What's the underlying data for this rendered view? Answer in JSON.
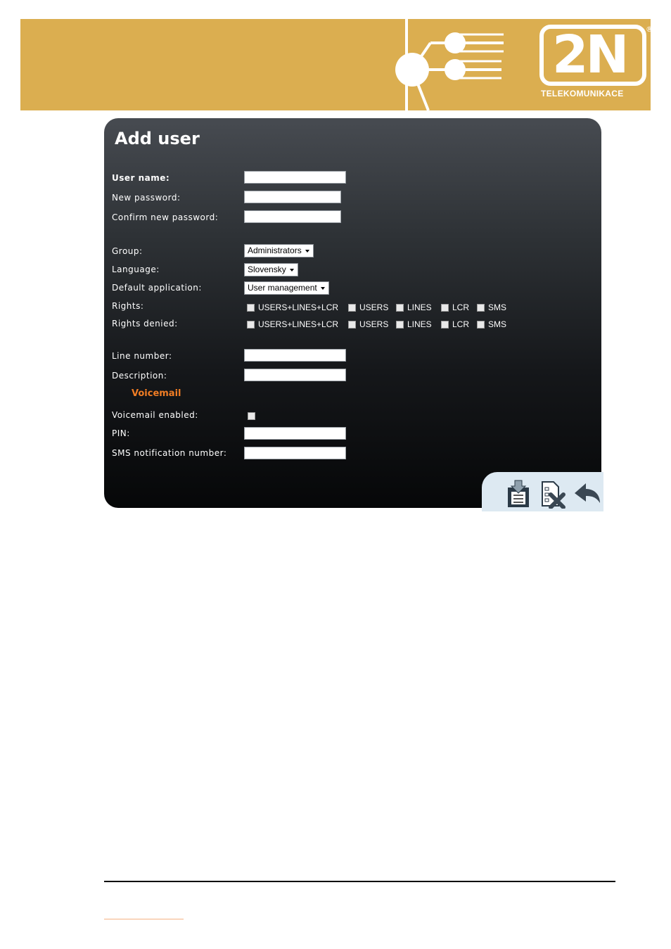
{
  "brand": {
    "logo_text": "2N",
    "tagline": "TELEKOMUNIKACE",
    "registered_mark": "®",
    "color": "#dbae50"
  },
  "form": {
    "title": "Add user",
    "fields": {
      "user_name": {
        "label": "User name:",
        "value": ""
      },
      "new_password": {
        "label": "New password:",
        "value": ""
      },
      "confirm_password": {
        "label": "Confirm new password:",
        "value": ""
      },
      "group": {
        "label": "Group:",
        "value": "Administrators"
      },
      "language": {
        "label": "Language:",
        "value": "Slovensky"
      },
      "default_application": {
        "label": "Default application:",
        "value": "User management"
      },
      "line_number": {
        "label": "Line number:",
        "value": ""
      },
      "description": {
        "label": "Description:",
        "value": ""
      }
    },
    "rights": {
      "label": "Rights:",
      "options": [
        "USERS+LINES+LCR",
        "USERS",
        "LINES",
        "LCR",
        "SMS"
      ]
    },
    "rights_denied": {
      "label": "Rights denied:",
      "options": [
        "USERS+LINES+LCR",
        "USERS",
        "LINES",
        "LCR",
        "SMS"
      ]
    },
    "voicemail": {
      "section_title": "Voicemail",
      "enabled_label": "Voicemail enabled:",
      "enabled": false,
      "pin_label": "PIN:",
      "sms_label": "SMS notification number:"
    },
    "section_color": "#f07d24"
  },
  "actions": {
    "icons": [
      "save-icon",
      "delete-icon",
      "back-icon"
    ]
  }
}
